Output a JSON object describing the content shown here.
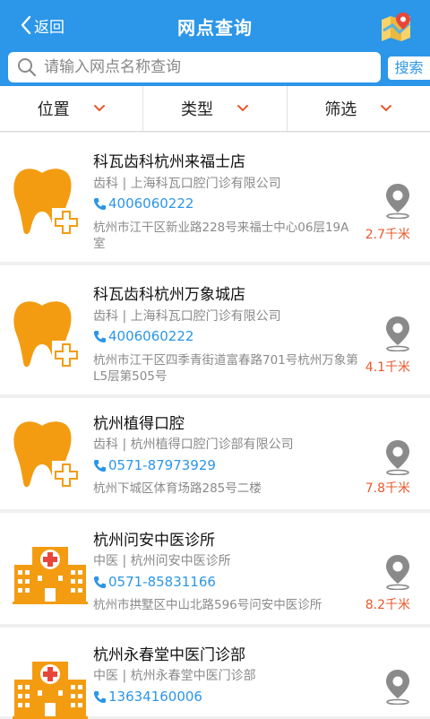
{
  "header": {
    "back_label": "返回",
    "title": "网点查询"
  },
  "search": {
    "placeholder": "请输入网点名称查询",
    "button_label": "搜索"
  },
  "filters": [
    {
      "label": "位置"
    },
    {
      "label": "类型"
    },
    {
      "label": "筛选"
    }
  ],
  "results": [
    {
      "icon": "tooth-icon",
      "name": "科瓦齿科杭州来福士店",
      "category": "齿科 | 上海科瓦口腔门诊有限公司",
      "phone": "4006060222",
      "address": "杭州市江干区新业路228号来福士中心06层19A室",
      "distance": "2.7千米"
    },
    {
      "icon": "tooth-icon",
      "name": "科瓦齿科杭州万象城店",
      "category": "齿科 | 上海科瓦口腔门诊有限公司",
      "phone": "4006060222",
      "address": "杭州市江干区四季青街道富春路701号杭州万象第L5层第505号",
      "distance": "4.1千米"
    },
    {
      "icon": "tooth-icon",
      "name": "杭州植得口腔",
      "category": "齿科 | 杭州植得口腔门诊部有限公司",
      "phone": "0571-87973929",
      "address": "杭州下城区体育场路285号二楼",
      "distance": "7.8千米"
    },
    {
      "icon": "hospital-icon",
      "name": "杭州问安中医诊所",
      "category": "中医 | 杭州问安中医诊所",
      "phone": "0571-85831166",
      "address": "杭州市拱墅区中山北路596号问安中医诊所",
      "distance": "8.2千米"
    },
    {
      "icon": "hospital-icon",
      "name": "杭州永春堂中医门诊部",
      "category": "中医 | 杭州永春堂中医门诊部",
      "phone": "13634160006",
      "address": "",
      "distance": ""
    }
  ]
}
